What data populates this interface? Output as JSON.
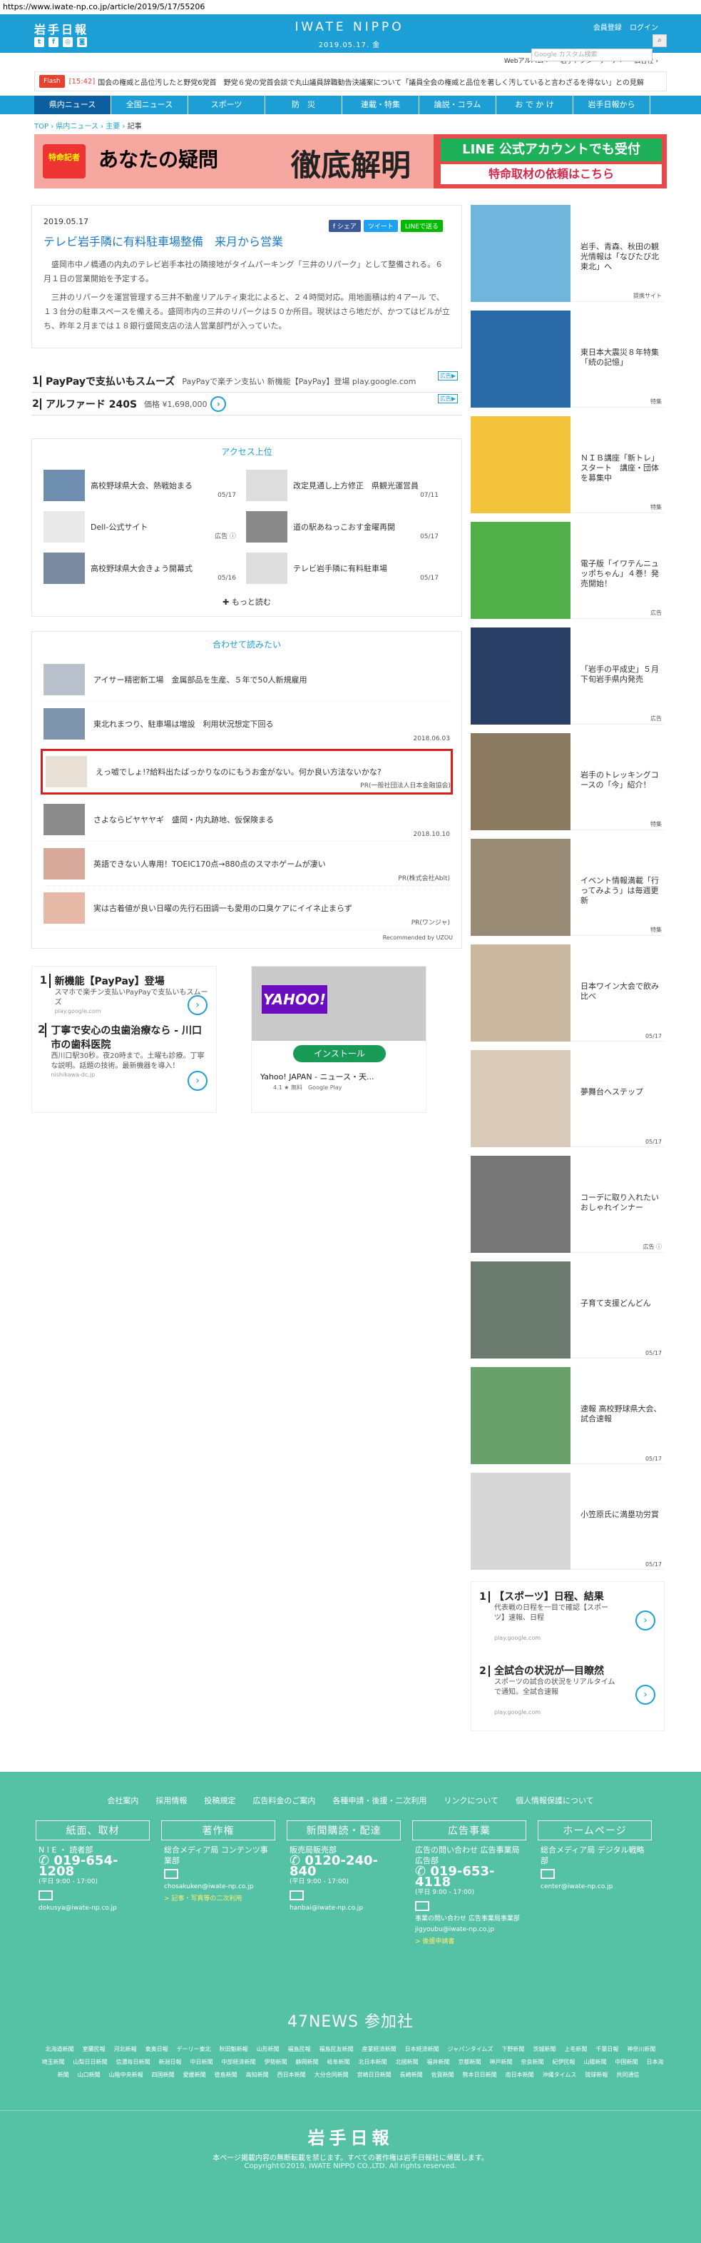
{
  "url": "https://www.iwate-np.co.jp/article/2019/5/17/55206",
  "header": {
    "logo": "岩手日報",
    "brand": "IWATE NIPPO",
    "date": "2019.05.17. 金",
    "register": "会員登録",
    "login": "ログイン",
    "search_placeholder": "Google カスタム検索",
    "social": [
      "t",
      "f",
      "◎",
      "◙"
    ]
  },
  "subnav": [
    "Webアルバム ›",
    "岩手ドクターサーチ ›",
    "広告社 ›"
  ],
  "ticker": {
    "label": "Flash",
    "time": "[15:42]",
    "text": "国会の権威と品位汚したと野党6党首　野党６党の党首会談で丸山議員辞職勧告決議案について「議員全会の権威と品位を著しく汚していると言わざるを得ない」との見解"
  },
  "nav": [
    "県内ニュース",
    "全国ニュース",
    "スポーツ",
    "防　災",
    "連載・特集",
    "論説・コラム",
    "お で か け",
    "岩手日報から"
  ],
  "breadcrumb": [
    "TOP",
    "県内ニュース",
    "主要",
    "記事"
  ],
  "banner": {
    "badge": "特命記者",
    "text1": "あなたの疑問",
    "text2": "徹底解明",
    "line1": "LINE 公式アカウントでも受付",
    "line2": "特命取材の依頼はこちら"
  },
  "article": {
    "date": "2019.05.17",
    "share": [
      "f シェア",
      "ツイート",
      "LINEで送る"
    ],
    "title": "テレビ岩手隣に有料駐車場整備　来月から営業",
    "body": [
      "盛岡市中ノ橋通の内丸のテレビ岩手本社の隣接地がタイムパーキング「三井のリパーク」として整備される。６月１日の営業開始を予定する。",
      "三井のリパークを運営管理する三井不動産リアルティ東北によると、２４時間対応。用地面積は約４アール で、１３台分の駐車スペースを備える。盛岡市内の三井のリパークは５０か所目。現状はさら地だが、かつてはビルが立ち、昨年２月までは１８銀行盛岡支店の法人営業部門が入っていた。"
    ]
  },
  "ad_text": {
    "rows": [
      {
        "n": "1",
        "t": "PayPayで支払いもスムーズ",
        "g": "PayPayで楽チン支払い 新機能【PayPay】登場 play.google.com"
      },
      {
        "n": "2",
        "t": "アルファード 240S",
        "g": "価格 ¥1,698,000"
      }
    ],
    "tag": "広告▶"
  },
  "ranking": {
    "title": "アクセス上位",
    "items": [
      {
        "t": "高校野球県大会、熱戦始まる",
        "d": "05/17"
      },
      {
        "t": "改定見通し上方修正　県観光運営員",
        "d": "07/11"
      },
      {
        "t": "Dell-公式サイト",
        "d": "広告 ⓘ"
      },
      {
        "t": "道の駅あねっこおす金曜再開",
        "d": "05/17"
      },
      {
        "t": "高校野球県大会きょう開幕式",
        "d": "05/16"
      },
      {
        "t": "テレビ岩手隣に有料駐車場",
        "d": "05/17"
      }
    ],
    "more": "✚ もっと読む"
  },
  "recommend": {
    "title": "合わせて読みたい",
    "items": [
      {
        "t": "アイサー精密新工場　金属部品を生産、５年で50人新規雇用",
        "d": ""
      },
      {
        "t": "東北れまつり、駐車場は増設　利用状況想定下回る",
        "d": "2018.06.03"
      },
      {
        "t": "えっ嘘でしょ!?給料出たばっかりなのにもうお金がない。何か良い方法ないかな?",
        "d": "PR(一般社団法人日本金融協会)"
      },
      {
        "t": "さよならビヤヤヤギ　盛岡・内丸跡地、仮保険まる",
        "d": "2018.10.10"
      },
      {
        "t": "英語できない人専用！TOEIC170点→880点のスマホゲームが凄い",
        "d": "PR(株式会社Ablt)"
      },
      {
        "t": "実は古着値が良い日曜の先行石田調一も愛用の口臭ケアにイイネ止まらず",
        "d": "PR(ワンジャ)"
      }
    ],
    "by": "Recommended by UZOU"
  },
  "bottom_ads": {
    "a": [
      {
        "n": "1",
        "t": "新機能【PayPay】登場",
        "s": "スマホで楽チン支払いPayPayで支払いもスムーズ",
        "s2": "play.google.com"
      },
      {
        "n": "2",
        "t": "丁寧で安心の虫歯治療なら - 川口市の歯科医院",
        "s": "西川口駅30秒。夜20時まで。土曜も診療。丁寧な説明。話題の技術。最新機器を導入！",
        "s2": "nishikawa-dc.jp"
      }
    ],
    "tag": "広告▶",
    "yahoo_logo": "YAHOO!",
    "install": "インストール",
    "app": "Yahoo! JAPAN - ニュース・天...",
    "rating": "4.1 ★ 無料　Google Play"
  },
  "side": [
    {
      "t": "岩手、青森、秋田の観光情報は「なびたび北東北」へ",
      "s": "提携サイト",
      "c": "#6fb5dc"
    },
    {
      "t": "東日本大震災８年特集「続の記憶」",
      "s": "特集",
      "c": "#2a6aa8"
    },
    {
      "t": "ＮＩＢ講座「新トレ」スタート　講座・団体を募集中",
      "s": "特集",
      "c": "#f3c33c"
    },
    {
      "t": "電子版「イワテんニュッポちゃん」４巻！発売開始！",
      "s": "広告",
      "c": "#52b04b"
    },
    {
      "t": "「岩手の平成史」５月下旬岩手県内発売",
      "s": "広告",
      "c": "#2a3f66"
    },
    {
      "t": "岩手のトレッキングコースの「今」紹介！",
      "s": "特集",
      "c": "#8a7a60"
    },
    {
      "t": "イベント情報満載「行ってみよう」は毎週更新",
      "s": "特集",
      "c": "#9a8b76"
    },
    {
      "t": "日本ワイン大会で飲み比べ",
      "s": "05/17",
      "c": "#c9b7a0"
    },
    {
      "t": "夢舞台へステップ",
      "s": "05/17",
      "c": "#d8c9b8"
    },
    {
      "t": "コーデに取り入れたいおしゃれインナー",
      "s": "広告 ⓘ",
      "c": "#777"
    },
    {
      "t": "子育て支援どんどん",
      "s": "05/17",
      "c": "#6b7a6e"
    },
    {
      "t": "速報 高校野球県大会、試合速報",
      "s": "05/17",
      "c": "#6aa06a"
    },
    {
      "t": "小笠原氏に満塁功労賞",
      "s": "05/17",
      "c": "#d7d7d7"
    }
  ],
  "side_ads": [
    {
      "n": "1",
      "t": "【スポーツ】日程、結果",
      "s": "代表戦の日程を一目で確認【スポーツ】速報、日程",
      "s2": "play.google.com"
    },
    {
      "n": "2",
      "t": "全試合の状況が一目瞭然",
      "s": "スポーツの試合の状況をリアルタイムで通知。全試合速報",
      "s2": "play.google.com"
    }
  ],
  "footer": {
    "links": [
      "会社案内",
      "採用情報",
      "投稿規定",
      "広告料金のご案内",
      "各種申請・後援・二次利用",
      "リンクについて",
      "個人情報保護について"
    ],
    "cols": [
      {
        "hd": "紙面、取材",
        "l1": "N I E ・ 読者部",
        "tel": "019-654-1208",
        "hrs": "(平日 9:00 - 17:00)",
        "mail": "dokusya@iwate-np.co.jp",
        "link": ""
      },
      {
        "hd": "著作権",
        "l1": "総合メディア局 コンテンツ事業部",
        "tel": "",
        "hrs": "",
        "mail": "chosakuken@iwate-np.co.jp",
        "link": "> 記事・写真等の二次利用"
      },
      {
        "hd": "新聞購読・配達",
        "l1": "販売局販売部",
        "tel": "0120-240-840",
        "hrs": "(平日 9:00 - 17:00)",
        "mail": "hanbai@iwate-np.co.jp",
        "link": ""
      },
      {
        "hd": "広告事業",
        "l1": "広告の問い合わせ 広告事業局広告部",
        "tel": "019-653-4118",
        "hrs": "(平日 9:00 - 17:00)",
        "mail": "事業の問い合わせ 広告事業局事業部 jigyoubu@iwate-np.co.jp",
        "link": "> 後援申請書"
      },
      {
        "hd": "ホームページ",
        "l1": "総合メディア局 デジタル戦略部",
        "tel": "",
        "hrs": "",
        "mail": "center@iwate-np.co.jp",
        "link": ""
      }
    ],
    "news47": "47NEWS 参加社",
    "papers": [
      "北海道新聞",
      "室蘭民報",
      "河北新報",
      "東奥日報",
      "デーリー東北",
      "秋田魁新報",
      "山形新聞",
      "福島民報",
      "福島民友新聞",
      "産業経済新聞",
      "日本経済新聞",
      "ジャパンタイムズ",
      "下野新聞",
      "茨城新聞",
      "上毛新聞",
      "千葉日報",
      "神奈川新聞",
      "埼玉新聞",
      "山梨日日新聞",
      "信濃毎日新聞",
      "新潟日報",
      "中日新聞",
      "中部経済新聞",
      "伊勢新聞",
      "静岡新聞",
      "岐阜新聞",
      "北日本新聞",
      "北國新聞",
      "福井新聞",
      "京都新聞",
      "神戸新聞",
      "奈良新聞",
      "紀伊民報",
      "山陽新聞",
      "中国新聞",
      "日本海新聞",
      "山口新聞",
      "山陰中央新報",
      "四国新聞",
      "愛媛新聞",
      "徳島新聞",
      "高知新聞",
      "西日本新聞",
      "大分合同新聞",
      "宮崎日日新聞",
      "長崎新聞",
      "佐賀新聞",
      "熊本日日新聞",
      "南日本新聞",
      "沖縄タイムス",
      "琉球新報",
      "共同通信"
    ],
    "logo": "岩手日報",
    "note": "本ページ掲載内容の無断転載を禁じます。すべての著作権は岩手日報社に帰属します。",
    "copy": "Copyright©2019, IWATE NIPPO CO.,LTD. All rights reserved."
  }
}
